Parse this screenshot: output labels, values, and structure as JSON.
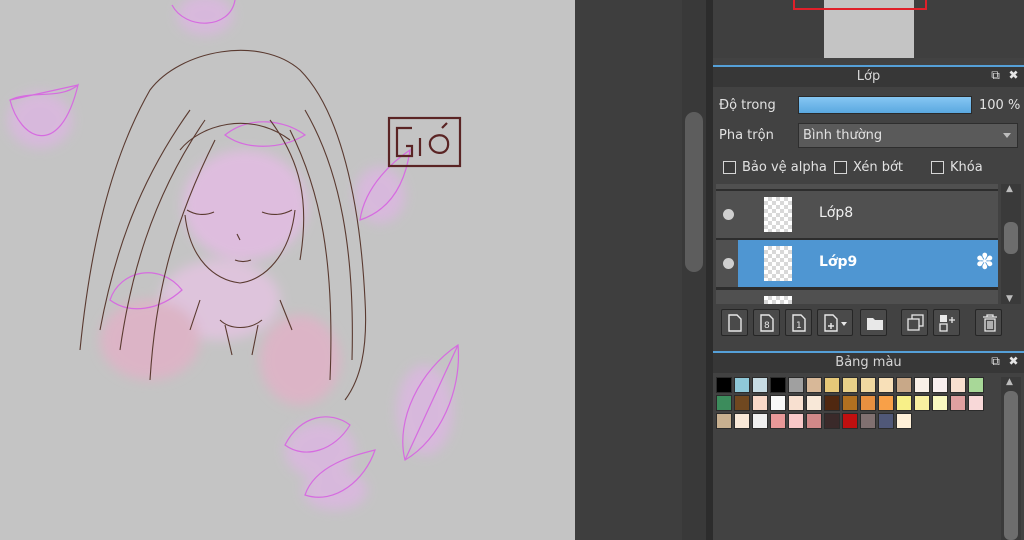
{
  "layer_panel": {
    "title": "Lớp",
    "opacity_label": "Độ trong",
    "opacity_value": "100 %",
    "opacity_level": 1.0,
    "blend_label": "Pha trộn",
    "blend_value": "Bình thường",
    "protect_alpha_label": "Bảo vệ alpha",
    "clipping_label": "Xén bớt",
    "lock_label": "Khóa",
    "layers": [
      {
        "name": "Lớp8",
        "visible": true,
        "selected": false
      },
      {
        "name": "Lớp9",
        "visible": true,
        "selected": true
      }
    ],
    "toolbar_icons": [
      "new-layer-icon",
      "new-8bit-layer-icon",
      "new-1bit-layer-icon",
      "add-layer-dropdown-icon",
      "new-folder-icon",
      "duplicate-layer-icon",
      "merge-layer-icon",
      "delete-layer-icon"
    ]
  },
  "palette_panel": {
    "title": "Bảng màu",
    "colors": [
      [
        "#000000",
        "#8fc8d8",
        "#c8dce4",
        "#000000",
        "#a0a0a0",
        "#d8b898",
        "#e6c878",
        "#e8d088",
        "#f0d8a0",
        "#f8e0b8",
        "#c8a888",
        "#f8f0e8",
        "#f8f0f0",
        "#f8e0d0",
        "#a8d898"
      ],
      [
        "#3c8c5c",
        "#704820",
        "#f8d8c8",
        "#f8f8f8",
        "#f8e0d0",
        "#f8e8d8",
        "#502810",
        "#b07020",
        "#e89040",
        "#f8a048",
        "#f8f088",
        "#f8f0a0",
        "#f8f8c0",
        "#e0a0a0",
        "#f8d8d8"
      ],
      [
        "#c8b090",
        "#f8e8d8",
        "#f0f0f0",
        "#e89898",
        "#f8c8c8",
        "#d08888",
        "#3a2a2a",
        "#c01010",
        "#807070",
        "#505878",
        "#fff0d8"
      ]
    ]
  },
  "canvas": {
    "signature_text": "Gió",
    "background": "#c4c4c4"
  },
  "colors": {
    "accent": "#4f96d2",
    "panel_bg": "#424242",
    "navigator_frame": "#e0202a"
  }
}
